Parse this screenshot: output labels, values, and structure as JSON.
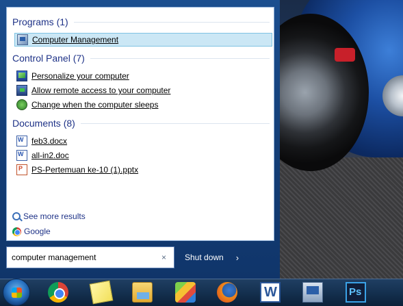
{
  "results": {
    "groups": [
      {
        "title": "Programs (1)",
        "items": [
          {
            "label": "Computer Management",
            "icon": "computer-management-icon",
            "selected": true
          }
        ]
      },
      {
        "title": "Control Panel (7)",
        "items": [
          {
            "label": "Personalize your computer",
            "icon": "personalization-icon"
          },
          {
            "label": "Allow remote access to your computer",
            "icon": "remote-access-icon"
          },
          {
            "label": "Change when the computer sleeps",
            "icon": "power-options-icon"
          }
        ]
      },
      {
        "title": "Documents (8)",
        "items": [
          {
            "label": "feb3.docx",
            "icon": "word-document-icon"
          },
          {
            "label": "all-in2.doc",
            "icon": "word-document-icon"
          },
          {
            "label": "PS-Pertemuan ke-10 (1).pptx",
            "icon": "powerpoint-document-icon"
          }
        ]
      }
    ],
    "see_more": "See more results",
    "google": "Google"
  },
  "search": {
    "value": "computer management",
    "clear_glyph": "×"
  },
  "shutdown": {
    "label": "Shut down",
    "arrow": "›"
  },
  "taskbar": {
    "pinned": [
      "Chrome",
      "Sticky Notes",
      "Windows Explorer",
      "BlueStacks",
      "Firefox",
      "Microsoft Word",
      "Computer Management",
      "Photoshop"
    ]
  },
  "colors": {
    "group_title": "#1e3287",
    "selection_bg": "#cbe7f5",
    "menu_bg": "#143f78"
  }
}
